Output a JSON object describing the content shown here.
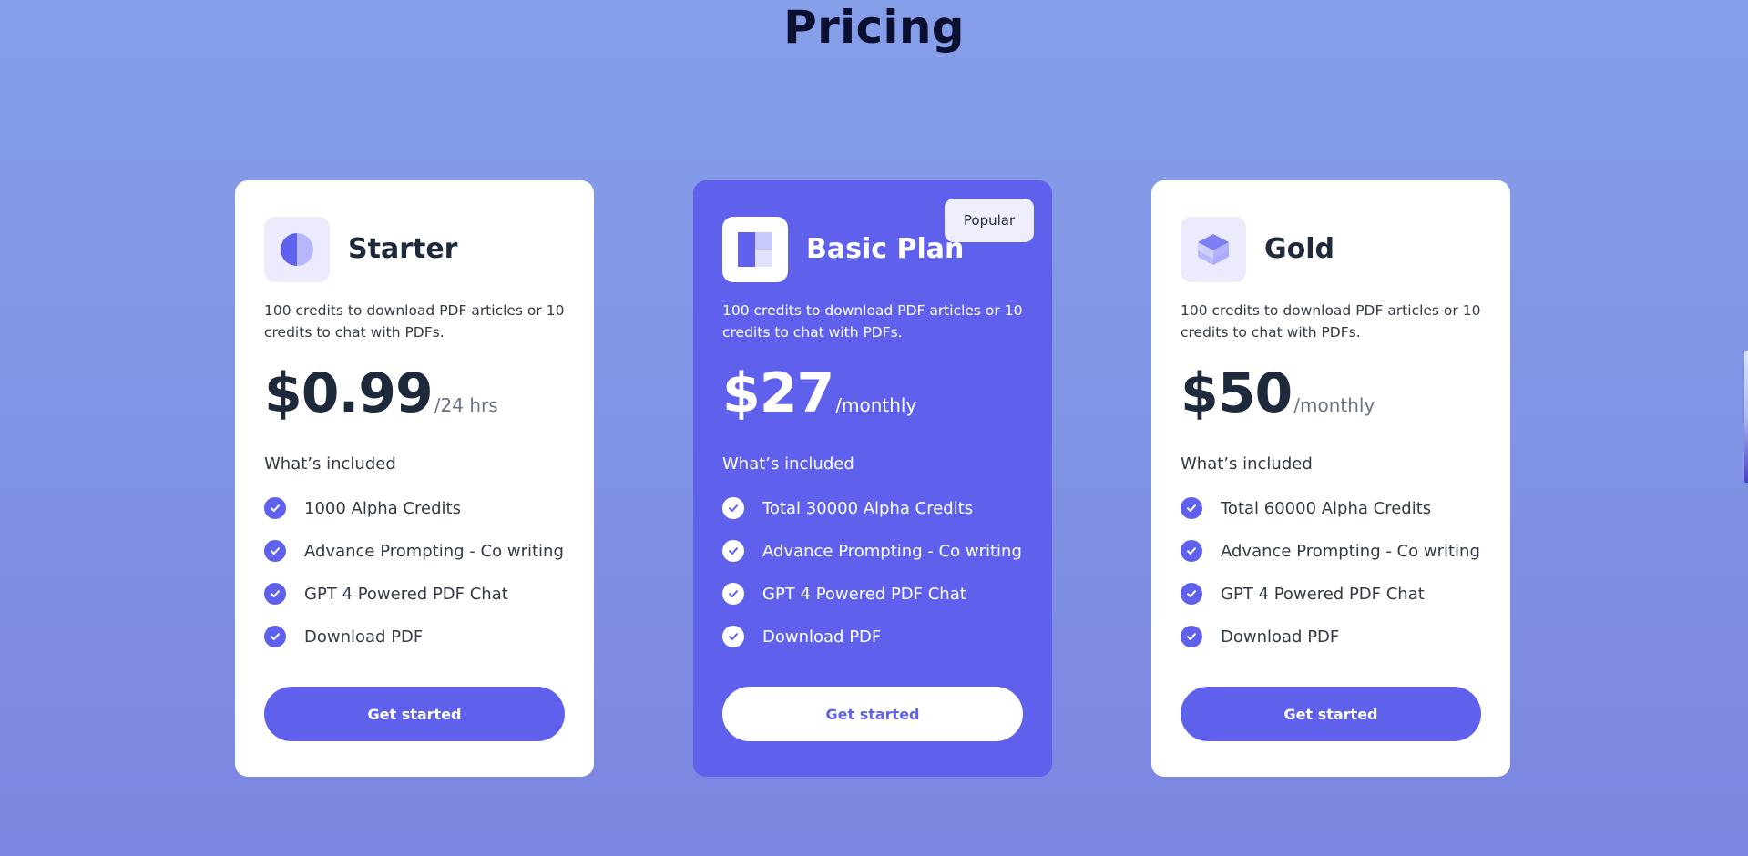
{
  "page": {
    "title": "Pricing"
  },
  "colors": {
    "accent": "#5f61ed",
    "background": "#8092e4",
    "card": "#ffffff",
    "heading": "#1e2a3b"
  },
  "plans": [
    {
      "name": "Starter",
      "icon": "half-circle-icon",
      "badge": "",
      "description": "100 credits to download PDF articles or 10 credits to chat with PDFs.",
      "price": "$0.99",
      "period": "/24 hrs",
      "included_label": "What’s included",
      "features": [
        "1000 Alpha Credits",
        "Advance Prompting - Co writing",
        "GPT 4 Powered PDF Chat",
        "Download PDF"
      ],
      "cta_label": "Get started",
      "featured": false
    },
    {
      "name": "Basic Plan",
      "icon": "grid-blocks-icon",
      "badge": "Popular",
      "description": "100 credits to download PDF articles or 10 credits to chat with PDFs.",
      "price": "$27",
      "period": "/monthly",
      "included_label": "What’s included",
      "features": [
        "Total 30000 Alpha Credits",
        "Advance Prompting - Co writing",
        "GPT 4 Powered PDF Chat",
        "Download PDF"
      ],
      "cta_label": "Get started",
      "featured": true
    },
    {
      "name": "Gold",
      "icon": "cube-icon",
      "badge": "",
      "description": "100 credits to download PDF articles or 10 credits to chat with PDFs.",
      "price": "$50",
      "period": "/monthly",
      "included_label": "What’s included",
      "features": [
        "Total 60000 Alpha Credits",
        "Advance Prompting - Co writing",
        "GPT 4 Powered PDF Chat",
        "Download PDF"
      ],
      "cta_label": "Get started",
      "featured": false
    }
  ]
}
